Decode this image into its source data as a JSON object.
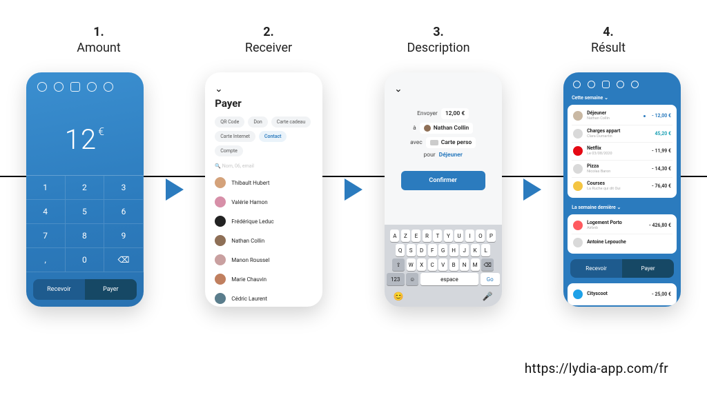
{
  "steps": [
    {
      "num": "1.",
      "label": "Amount"
    },
    {
      "num": "2.",
      "label": "Receiver"
    },
    {
      "num": "3.",
      "label": "Description"
    },
    {
      "num": "4.",
      "label": "Résult"
    }
  ],
  "footer_url": "https://lydia-app.com/fr",
  "screen1": {
    "amount_value": "12",
    "amount_currency": "€",
    "keys": [
      "1",
      "2",
      "3",
      "4",
      "5",
      "6",
      "7",
      "8",
      "9",
      ",",
      "0",
      "⌫"
    ],
    "recevoir": "Recevoir",
    "payer": "Payer"
  },
  "screen2": {
    "title": "Payer",
    "chips": [
      "QR Code",
      "Don",
      "Carte cadeau",
      "Carte Internet",
      "Contact",
      "Compte"
    ],
    "active_chip_index": 4,
    "search_placeholder": "Nom, 06, email",
    "contacts": [
      {
        "name": "Thibault Hubert",
        "color": "#D4A27A"
      },
      {
        "name": "Valérie Hamon",
        "color": "#D78FA8"
      },
      {
        "name": "Frédérique Leduc",
        "color": "#222"
      },
      {
        "name": "Nathan Collin",
        "color": "#8E6F56"
      },
      {
        "name": "Manon Roussel",
        "color": "#C9A0A0"
      },
      {
        "name": "Marie Chauvin",
        "color": "#C07F5F"
      },
      {
        "name": "Cédric Laurent",
        "color": "#5A7D8C"
      }
    ]
  },
  "screen3": {
    "lbl_send": "Envoyer",
    "val_send": "12,00 €",
    "lbl_to": "à",
    "val_to": "Nathan Collin",
    "lbl_with": "avec",
    "val_with": "Carte perso",
    "lbl_for": "pour",
    "val_for": "Déjeuner",
    "confirm": "Confirmer",
    "kbd_rows": [
      [
        "A",
        "Z",
        "E",
        "R",
        "T",
        "Y",
        "U",
        "I",
        "O",
        "P"
      ],
      [
        "Q",
        "S",
        "D",
        "F",
        "G",
        "H",
        "J",
        "K",
        "L"
      ],
      [
        "⇧",
        "W",
        "X",
        "C",
        "V",
        "B",
        "N",
        "M",
        "⌫"
      ]
    ],
    "kbd_123": "123",
    "kbd_space": "espace",
    "kbd_go": "Go"
  },
  "screen4": {
    "section1": "Cette semaine",
    "section2": "La semaine dernière",
    "tx1": [
      {
        "name": "Déjeuner",
        "sub": "Nathan Collin",
        "amt": "- 12,00 €",
        "color": "#2B7BBE",
        "new": true,
        "ico": "#C9B8A3"
      },
      {
        "name": "Charges appart",
        "sub": "Clara Dumartin",
        "amt": "45,20 €",
        "color": "#1EA1B5",
        "ico": "#D9D9D9"
      },
      {
        "name": "Netflix",
        "sub": "Le 03/08/2020",
        "amt": "- 11,99 €",
        "color": "#333",
        "ico": "#E50914"
      },
      {
        "name": "Pizza",
        "sub": "Nicolas Baron",
        "amt": "- 14,30 €",
        "color": "#333",
        "ico": "#D9D9D9"
      },
      {
        "name": "Courses",
        "sub": "La Ruche qui dit Oui",
        "amt": "- 76,40 €",
        "color": "#333",
        "ico": "#F4C542"
      }
    ],
    "tx2": [
      {
        "name": "Logement Porto",
        "sub": "Airbnb",
        "amt": "- 426,80 €",
        "color": "#333",
        "ico": "#FF5A5F"
      },
      {
        "name": "Antoine Lepouche",
        "sub": "",
        "amt": "",
        "color": "#333",
        "ico": "#D9D9D9"
      }
    ],
    "tx3": [
      {
        "name": "Cityscoot",
        "sub": "",
        "amt": "- 25,00 €",
        "color": "#333",
        "ico": "#1EA1E8"
      }
    ],
    "recevoir": "Recevoir",
    "payer": "Payer"
  }
}
